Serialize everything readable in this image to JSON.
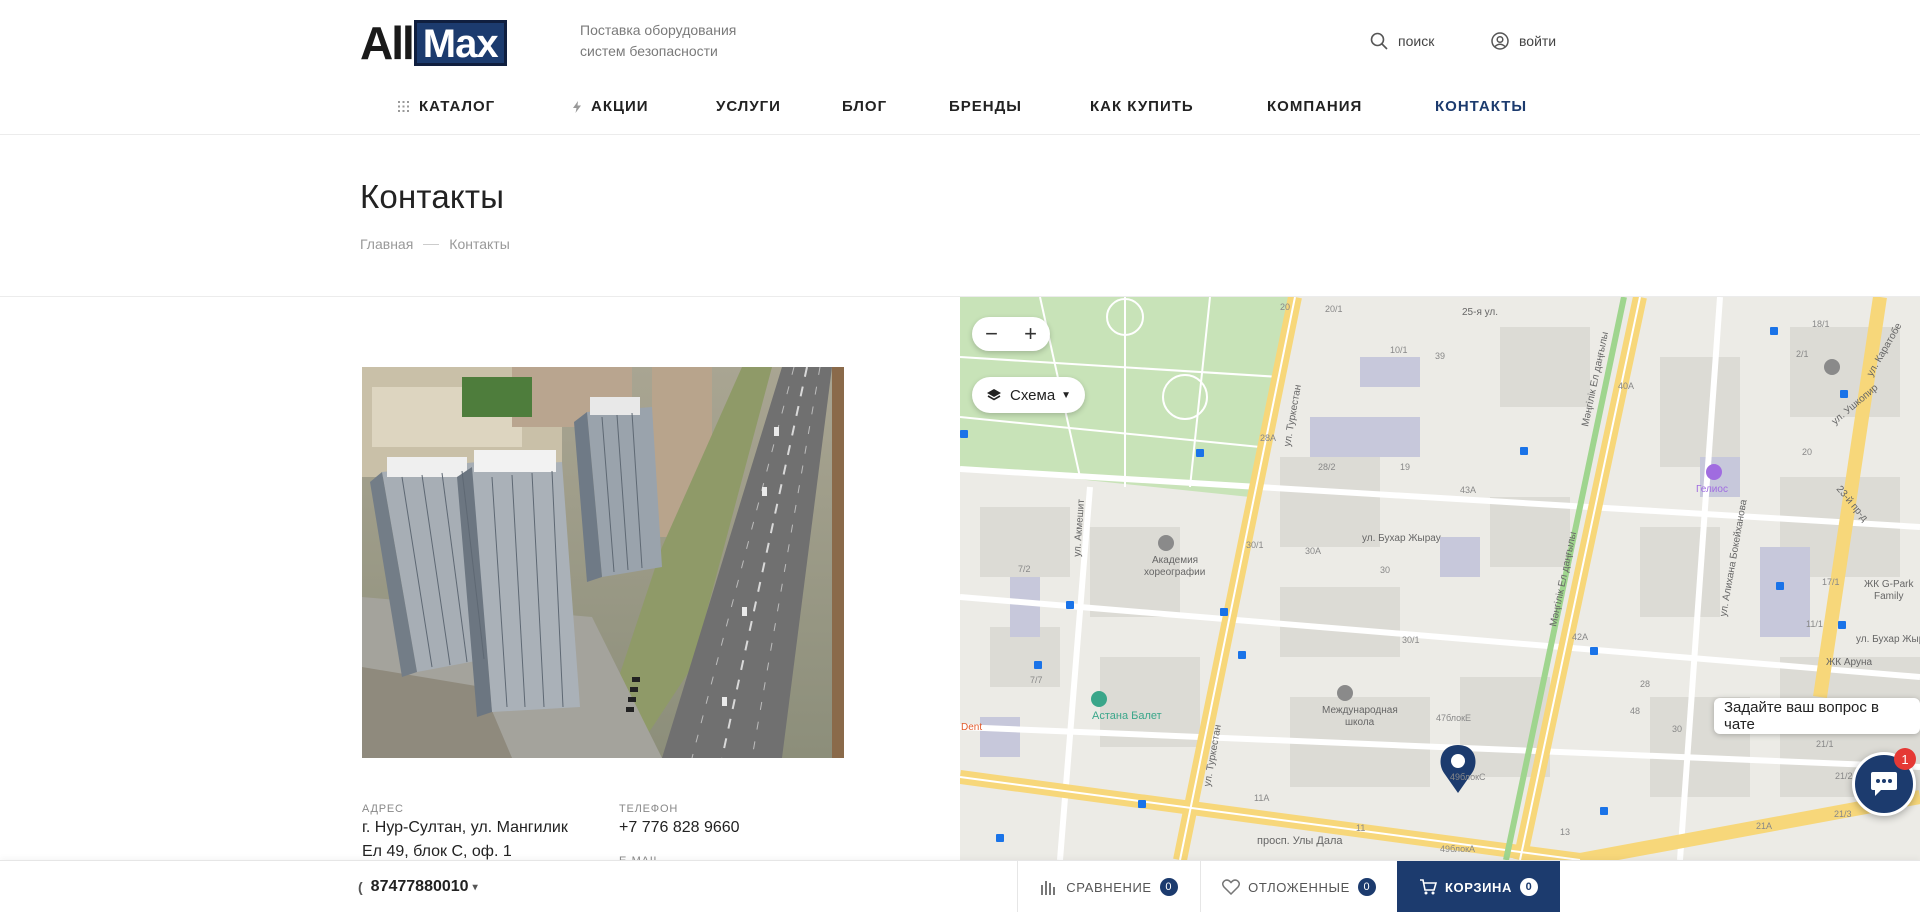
{
  "header": {
    "logo_left": "All",
    "logo_right": "Max",
    "slogan_line1": "Поставка оборудования",
    "slogan_line2": "систем безопасности",
    "search_label": "поиск",
    "login_label": "войти"
  },
  "nav": {
    "items": [
      {
        "label": "КАТАЛОГ"
      },
      {
        "label": "АКЦИИ"
      },
      {
        "label": "УСЛУГИ"
      },
      {
        "label": "БЛОГ"
      },
      {
        "label": "БРЕНДЫ"
      },
      {
        "label": "КАК КУПИТЬ"
      },
      {
        "label": "КОМПАНИЯ"
      },
      {
        "label": "КОНТАКТЫ"
      }
    ]
  },
  "page": {
    "title": "Контакты",
    "breadcrumb_home": "Главная",
    "breadcrumb_current": "Контакты"
  },
  "contacts": {
    "address_label": "АДРЕС",
    "address_line1": "г. Нур-Султан, ул. Мангилик",
    "address_line2": "Ел 49, блок С, оф. 1",
    "phone_label": "ТЕЛЕФОН",
    "phone_value": "+7 776 828 9660",
    "email_label": "E-MAIL"
  },
  "map": {
    "zoom_out": "−",
    "zoom_in": "+",
    "layer_label": "Схема",
    "labels": {
      "turkestan1": "ул. Туркестан",
      "turkestan2": "ул. Туркестан",
      "mangilik1": "Мәңгілік Ел даңғылы",
      "mangilik2": "Мәңгілік Ел даңғылы",
      "bukhar1": "ул. Бухар Жырау",
      "bukhar2": "ул. Бухар Жырау",
      "akmeshit": "ул. Акмешит",
      "bokeikhanov": "ул. Алихана Бокейханова",
      "ulydala": "просп. Улы Дала",
      "ushkopir": "ул. Ушкопир",
      "karatobe": "ул. Каратобе",
      "proezd23": "23-й пр-д",
      "ya25": "25-я ул.",
      "academy1": "Академия",
      "academy2": "хореографии",
      "ballet": "Астана Балет",
      "school1": "Международная",
      "school2": "школа",
      "helios": "Гелиос",
      "gpark1": "ЖК G-Park",
      "gpark2": "Family",
      "aruna": "ЖК Аруна",
      "dent": "Dent"
    },
    "numbers": [
      "20",
      "20/1",
      "10/1",
      "39",
      "28A",
      "28/2",
      "19",
      "43A",
      "30/1",
      "30A",
      "30",
      "30/1",
      "42A",
      "30",
      "7/2",
      "7/7",
      "11A",
      "11",
      "13",
      "48",
      "28",
      "18/1",
      "2/1",
      "20",
      "17/1",
      "11/1",
      "21/1",
      "21/2",
      "21/3",
      "21A",
      "40A",
      "47блокЕ",
      "49блокС",
      "49блокА"
    ]
  },
  "chat": {
    "tooltip": "Задайте ваш вопрос в чате",
    "badge": "1"
  },
  "bottom_bar": {
    "phone": "87477880010",
    "compare_label": "СРАВНЕНИЕ",
    "compare_count": "0",
    "deferred_label": "ОТЛОЖЕННЫЕ",
    "deferred_count": "0",
    "cart_label": "КОРЗИНА",
    "cart_count": "0"
  },
  "colors": {
    "brand": "#1c3b6e",
    "text": "#222222",
    "muted": "#999999"
  }
}
